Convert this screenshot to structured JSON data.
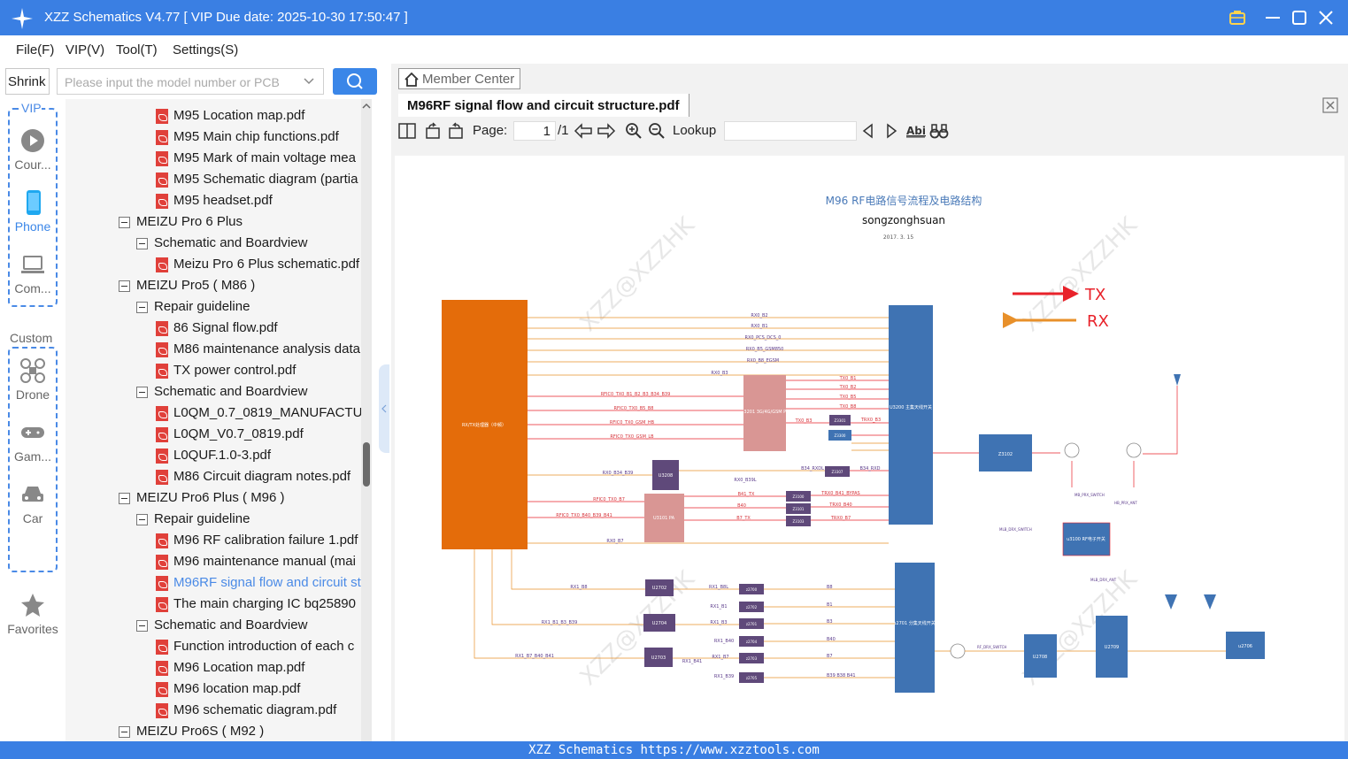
{
  "window": {
    "title": "XZZ Schematics V4.77 [ VIP Due date: 2025-10-30 17:50:47 ]"
  },
  "menu": [
    "File(F)",
    "VIP(V)",
    "Tool(T)",
    "Settings(S)"
  ],
  "left": {
    "shrink_label": "Shrink",
    "search_placeholder": "Please input the model number or PCB"
  },
  "sidebar": {
    "vip_label": "VIP",
    "custom_label": "Custom",
    "items": [
      "Cour...",
      "Phone",
      "Com...",
      "Drone",
      "Gam...",
      "Car",
      "Favorites"
    ]
  },
  "tree": [
    {
      "level": 3,
      "type": "pdf",
      "label": "M95 Location map.pdf"
    },
    {
      "level": 3,
      "type": "pdf",
      "label": "M95 Main chip functions.pdf"
    },
    {
      "level": 3,
      "type": "pdf",
      "label": "M95 Mark of main voltage mea"
    },
    {
      "level": 3,
      "type": "pdf",
      "label": "M95 Schematic diagram (partia"
    },
    {
      "level": 3,
      "type": "pdf",
      "label": "M95 headset.pdf"
    },
    {
      "level": 1,
      "type": "folder",
      "label": "MEIZU Pro 6 Plus"
    },
    {
      "level": 2,
      "type": "folder",
      "label": "Schematic and Boardview"
    },
    {
      "level": 3,
      "type": "pdf",
      "label": "Meizu Pro 6 Plus schematic.pdf"
    },
    {
      "level": 1,
      "type": "folder",
      "label": "MEIZU Pro5 ( M86 )"
    },
    {
      "level": 2,
      "type": "folder",
      "label": "Repair guideline"
    },
    {
      "level": 3,
      "type": "pdf",
      "label": "86 Signal flow.pdf"
    },
    {
      "level": 3,
      "type": "pdf",
      "label": "M86 maintenance analysis data"
    },
    {
      "level": 3,
      "type": "pdf",
      "label": "TX power control.pdf"
    },
    {
      "level": 2,
      "type": "folder",
      "label": "Schematic and Boardview"
    },
    {
      "level": 3,
      "type": "pdf",
      "label": "L0QM_0.7_0819_MANUFACTURE"
    },
    {
      "level": 3,
      "type": "pdf",
      "label": "L0QM_V0.7_0819.pdf"
    },
    {
      "level": 3,
      "type": "pdf",
      "label": "L0QUF.1.0-3.pdf"
    },
    {
      "level": 3,
      "type": "pdf",
      "label": "M86 Circuit diagram notes.pdf"
    },
    {
      "level": 1,
      "type": "folder",
      "label": "MEIZU Pro6 Plus ( M96 )"
    },
    {
      "level": 2,
      "type": "folder",
      "label": "Repair guideline"
    },
    {
      "level": 3,
      "type": "pdf",
      "label": "M96 RF calibration failure 1.pdf"
    },
    {
      "level": 3,
      "type": "pdf",
      "label": "M96 maintenance manual (mai"
    },
    {
      "level": 3,
      "type": "pdf",
      "label": "M96RF signal flow and circuit st",
      "selected": true
    },
    {
      "level": 3,
      "type": "pdf",
      "label": "The main charging IC bq25890"
    },
    {
      "level": 2,
      "type": "folder",
      "label": "Schematic and Boardview"
    },
    {
      "level": 3,
      "type": "pdf",
      "label": "Function introduction of each c"
    },
    {
      "level": 3,
      "type": "pdf",
      "label": "M96 Location map.pdf"
    },
    {
      "level": 3,
      "type": "pdf",
      "label": "M96 location map.pdf"
    },
    {
      "level": 3,
      "type": "pdf",
      "label": "M96 schematic diagram.pdf"
    },
    {
      "level": 1,
      "type": "folder",
      "label": "MEIZU Pro6S ( M92 )"
    }
  ],
  "viewer": {
    "member_center": "Member Center",
    "doc_tab": "M96RF signal flow and circuit structure.pdf",
    "page_label": "Page:",
    "page_current": "1",
    "page_total": "/1",
    "lookup_label": "Lookup"
  },
  "diagram": {
    "title": "M96 RF电路信号流程及电路结构",
    "author": "songzonghsuan",
    "date": "2017. 3. 15",
    "watermark": "XZZ@XZZHK",
    "legend_tx": "TX",
    "legend_rx": "RX",
    "main_block": "RX/TX处理器（中频）",
    "u3200": "U3200 主集天线开关",
    "u3201": "U3201 3G/4G/GSM PA",
    "u3208": "U3208",
    "u3101": "U3101 PA",
    "z3102": "Z3102",
    "u3100": "u3100 RF电子开关",
    "u2701": "u2701 分集天线开关",
    "u2708": "U2708",
    "u2709": "U2709",
    "u2706": "u2706",
    "u2702": "U2702",
    "u2704": "U2704",
    "u2703": "U2703",
    "z3301": "Z3301",
    "z3300": "Z3300",
    "z3307": "Z3307",
    "z3100": "Z3100",
    "z3101": "Z3101",
    "z3103": "Z3103",
    "rx_labels": [
      "RX0_B2",
      "RX0_B1",
      "RX0_PCS_DCS_0",
      "RX0_B5_GSM850",
      "RX0_B8_EGSM"
    ],
    "tx_labels": [
      "TX0_B1",
      "TX0_B2",
      "TX0_B5",
      "TX0_B8"
    ],
    "misc_labels": [
      "RX0_B3",
      "RFIC0_TX0_B1_B2_B3_B34_B39",
      "RFIC0_TX0_B5_B8",
      "RFIC0_TX0_GSM_HB",
      "RFIC0_TX0_GSM_LB",
      "TX0_B3",
      "TRX0_B3",
      "B34_RXDL",
      "B34_RXD",
      "RX0_B34_B39",
      "RX0_B39L",
      "RFIC0_TX0_B7",
      "RFIC0_TX0_B40_B39_B41",
      "B41_TX",
      "B40",
      "B7_TX",
      "TRX0_B41_BYPAS",
      "TRX0_B40",
      "TRX0_B7",
      "RX0_B7",
      "MB_PRX_SWITCH",
      "MLB_DRX_SWITCH",
      "HB_PRX_ANT",
      "MLB_DRX_ANT",
      "RF_DRX_SWITCH"
    ],
    "bottom_left": [
      "RX1_B8",
      "RX1_B1_B3_B39",
      "RX1_B7_B40_B41"
    ],
    "bottom_mid": [
      "RX1_B8L",
      "RX1_B1",
      "RX1_B3",
      "RX1_B40",
      "RX1_B7",
      "RX1_B41",
      "RX1_B39"
    ],
    "bottom_filters": [
      "z2700",
      "z2702",
      "z2701",
      "z2704",
      "z2703",
      "z2705"
    ],
    "bottom_right": [
      "B8",
      "B1",
      "B3",
      "B40",
      "B7",
      "B39 B38 B41"
    ]
  },
  "status": "XZZ Schematics https://www.xzztools.com",
  "colors": {
    "titlebar": "#3a7fe3",
    "accent": "#3a86e8",
    "orange_block": "#e46c0a",
    "blue_block": "#3f73b3",
    "pink_block": "#d99694",
    "purple_block": "#5f497a",
    "tx_red": "#e8222a",
    "rx_orange": "#e8902a"
  }
}
